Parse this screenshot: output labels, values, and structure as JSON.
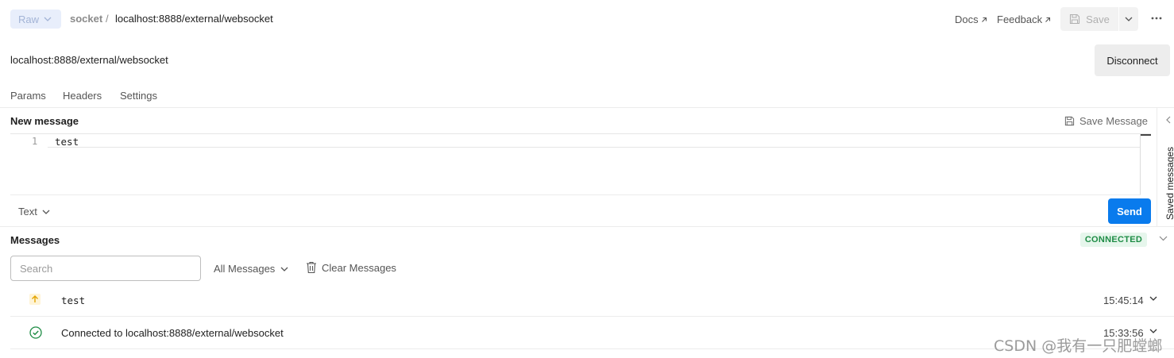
{
  "topbar": {
    "request_type": "Raw",
    "breadcrumb_parent": "socket",
    "breadcrumb_sep": "/",
    "breadcrumb_current": "localhost:8888/external/websocket",
    "docs_label": "Docs",
    "feedback_label": "Feedback",
    "save_label": "Save"
  },
  "url": {
    "value": "localhost:8888/external/websocket",
    "disconnect_label": "Disconnect"
  },
  "tabs": [
    {
      "label": "Params"
    },
    {
      "label": "Headers"
    },
    {
      "label": "Settings"
    }
  ],
  "new_message": {
    "title": "New message",
    "save_message_label": "Save Message",
    "line_number": "1",
    "content": "test",
    "format": "Text",
    "send_label": "Send"
  },
  "right_rail": {
    "label": "Saved messages"
  },
  "messages": {
    "title": "Messages",
    "status": "CONNECTED",
    "search_placeholder": "Search",
    "filter_label": "All Messages",
    "clear_label": "Clear Messages",
    "items": [
      {
        "direction": "sent",
        "icon": "arrow-up-icon",
        "text": "test",
        "time": "15:45:14"
      },
      {
        "direction": "status",
        "icon": "check-circle-icon",
        "text": "Connected to localhost:8888/external/websocket",
        "time": "15:33:56"
      }
    ]
  },
  "watermark": "CSDN @我有一只肥螳螂",
  "colors": {
    "accent": "#097bed",
    "connected_bg": "#e6f6ec",
    "connected_text": "#1e8c45",
    "sent_arrow": "#e3a300",
    "connected_icon": "#1e8c45"
  }
}
